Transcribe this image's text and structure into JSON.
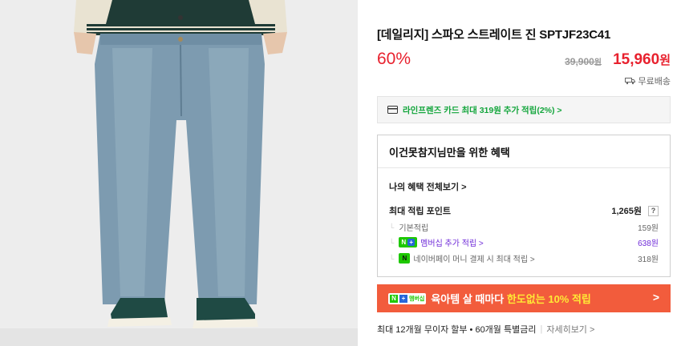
{
  "product": {
    "title": "[데일리지] 스파오 스트레이트 진 SPTJF23C41",
    "discount_rate": "60%",
    "original_price": "39,900",
    "original_unit": "원",
    "sale_price": "15,960",
    "sale_unit": "원",
    "shipping": "무료배송"
  },
  "card_offer": {
    "text": "라인프렌즈 카드 최대 319원 추가 적립(2%) >"
  },
  "benefit": {
    "heading": "이건못참지님만을 위한 혜택",
    "view_all": "나의 혜택 전체보기 >",
    "max_points_label": "최대 적립 포인트",
    "max_points_value": "1,265원",
    "help": "?",
    "rows": [
      {
        "label": "기본적립",
        "value": "159원"
      },
      {
        "badge_n": "N",
        "badge_plus": "+",
        "label": "멤버십 추가 적립 >",
        "value": "638원"
      },
      {
        "badge": "N",
        "label": "네이버페이 머니 결제 시 최대 적립 >",
        "value": "318원"
      }
    ]
  },
  "banner": {
    "tag_n": "N",
    "tag_plus": "+",
    "tag_m": "멤버십",
    "text1": "육아템 살 때마다 ",
    "text2": "한도없는 10% 적립",
    "arrow": ">"
  },
  "installment": {
    "text": "최대 12개월 무이자 할부 • 60개월 특별금리",
    "sep": "|",
    "more": "자세히보기 >"
  },
  "colors": {
    "accent_red": "#e8212e",
    "naver_green": "#1ec800",
    "banner_orange": "#f25c3c",
    "membership_purple": "#6f2bd8"
  }
}
